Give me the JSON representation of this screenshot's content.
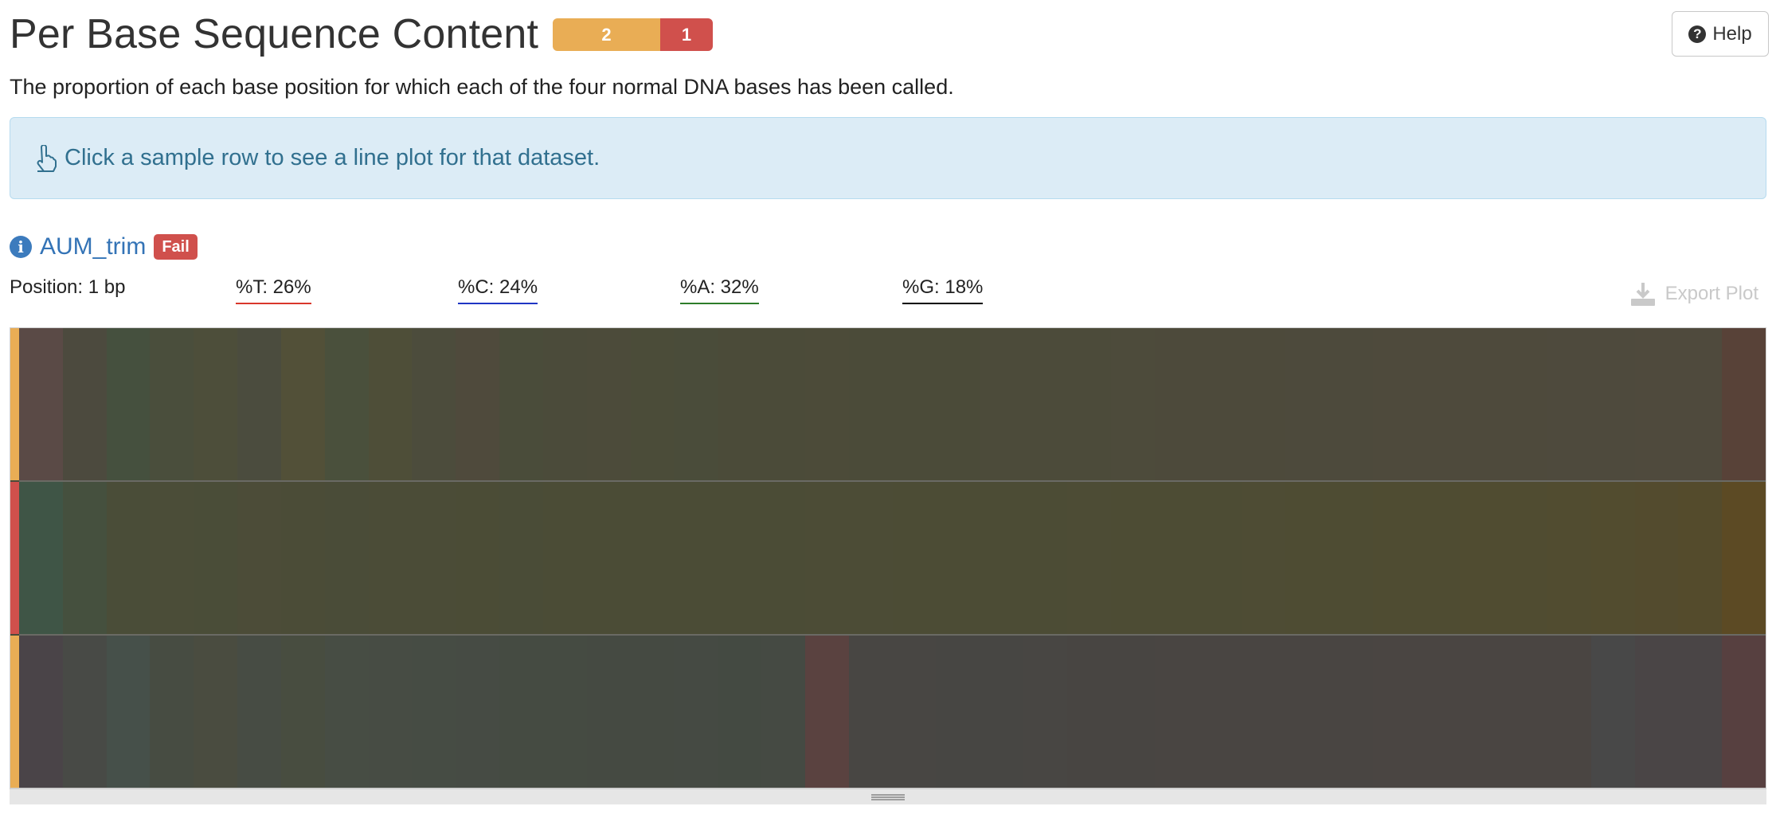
{
  "header": {
    "title": "Per Base Sequence Content",
    "status_counts": {
      "warn": "2",
      "fail": "1"
    },
    "help_label": "Help"
  },
  "description": "The proportion of each base position for which each of the four normal DNA bases has been called.",
  "alert": {
    "text": "Click a sample row to see a line plot for that dataset."
  },
  "sample": {
    "name": "AUM_trim",
    "status": "Fail"
  },
  "readout": {
    "position": "Position: 1 bp",
    "t": "%T: 26%",
    "c": "%C: 24%",
    "a": "%A: 32%",
    "g": "%G: 18%"
  },
  "export_label": "Export Plot",
  "colors": {
    "warn": "#e9ad55",
    "fail": "#d0504c",
    "t": "#d9372b",
    "c": "#1f36c4",
    "a": "#2e7d2a",
    "g": "#000000"
  },
  "heatmap": {
    "rows": [
      {
        "status": "warn",
        "cells": [
          "#5a4a46",
          "#4c4a3e",
          "#45503e",
          "#4a4e3c",
          "#4d4e3a",
          "#4b4c3e",
          "#525038",
          "#4a503c",
          "#4e4e38",
          "#4c4c3c",
          "#4f4a3c",
          "#4a4c3a",
          "#4b4b3a",
          "#4c4b3a",
          "#4b4c39",
          "#4a4c3a",
          "#4b4b39",
          "#4b4b39",
          "#4c4b39",
          "#4b4b39",
          "#4b4b39",
          "#4b4b39",
          "#4c4b3a",
          "#4c4b3a",
          "#4c4b3a",
          "#4d4b3b",
          "#4d4a3b",
          "#4d4a3b",
          "#4d4a3b",
          "#4d4a3c",
          "#4d4a3c",
          "#4e4a3c",
          "#4e4a3c",
          "#4e4a3c",
          "#4e4a3c",
          "#4e4a3d",
          "#4e4a3d",
          "#4f4a3d",
          "#4f4a3d",
          "#584238"
        ]
      },
      {
        "status": "fail",
        "cells": [
          "#3f5546",
          "#45503e",
          "#4a4d38",
          "#4b4d38",
          "#4a4d38",
          "#4c4c38",
          "#4b4c37",
          "#4a4c38",
          "#4b4c37",
          "#4b4c37",
          "#4b4c36",
          "#4a4c37",
          "#4b4c36",
          "#4b4c36",
          "#4b4c36",
          "#4b4c36",
          "#4b4c36",
          "#4b4c36",
          "#4c4c36",
          "#4c4c36",
          "#4c4c35",
          "#4c4c35",
          "#4c4c35",
          "#4c4c35",
          "#4d4c35",
          "#4d4c34",
          "#4d4c34",
          "#4d4c34",
          "#4e4c34",
          "#4e4c33",
          "#4e4c33",
          "#4f4c32",
          "#4f4c32",
          "#504c31",
          "#504c31",
          "#514c30",
          "#524c2f",
          "#534b2e",
          "#544b2c",
          "#5c4a24"
        ]
      },
      {
        "status": "warn",
        "cells": [
          "#4a4448",
          "#484a46",
          "#46504a",
          "#474c42",
          "#4a4c40",
          "#474c44",
          "#484d40",
          "#474d44",
          "#474c44",
          "#464c44",
          "#464b44",
          "#454b42",
          "#454b42",
          "#454a42",
          "#454a42",
          "#454a43",
          "#444a42",
          "#454a43",
          "#5a4240",
          "#484643",
          "#484643",
          "#474643",
          "#474643",
          "#484643",
          "#484542",
          "#484542",
          "#494542",
          "#494542",
          "#494542",
          "#494542",
          "#494542",
          "#4a4542",
          "#4a4542",
          "#4a4542",
          "#4a4542",
          "#4a4542",
          "#484848",
          "#4a4546",
          "#4a4546",
          "#574040"
        ]
      }
    ]
  }
}
